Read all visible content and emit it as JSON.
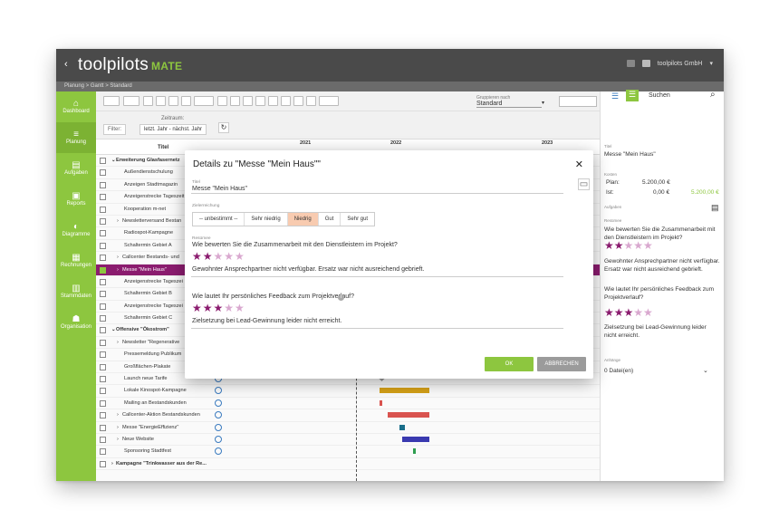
{
  "app": {
    "name": "toolpilots",
    "suffix": "MATE",
    "user": "toolpilots GmbH"
  },
  "breadcrumb": "Planung > Gantt > Standard",
  "sidebar": {
    "items": [
      {
        "label": "Dashboard",
        "icon": "home-icon"
      },
      {
        "label": "Planung",
        "icon": "list-icon"
      },
      {
        "label": "Aufgaben",
        "icon": "document-icon"
      },
      {
        "label": "Reports",
        "icon": "report-icon"
      },
      {
        "label": "Diagramme",
        "icon": "pie-icon"
      },
      {
        "label": "Rechnungen",
        "icon": "invoice-icon"
      },
      {
        "label": "Stammdaten",
        "icon": "database-icon"
      },
      {
        "label": "Organisation",
        "icon": "people-icon"
      }
    ]
  },
  "toolbar": {
    "group_label": "Gruppieren nach",
    "group_value": "Standard",
    "search_placeholder": "Suchen",
    "zoom_buttons": [
      "Q",
      "Q"
    ]
  },
  "filter": {
    "button": "Filter:",
    "range_label": "Zeitraum:",
    "range_value": "letzt. Jahr - nächst. Jahr"
  },
  "grid": {
    "title_col": "Titel",
    "years": [
      "2021",
      "2022",
      "2023"
    ],
    "rows": [
      {
        "label": "Erweiterung Glasfasernetz",
        "level": 0,
        "bold": true,
        "caret": "v"
      },
      {
        "label": "Außendienstschulung",
        "level": 1
      },
      {
        "label": "Anzeigen Stadtmagazin",
        "level": 1
      },
      {
        "label": "Anzeigenstrecke Tageszeit",
        "level": 1
      },
      {
        "label": "Kooperation m-net",
        "level": 1
      },
      {
        "label": "Newsletterversand Bestan",
        "level": 1,
        "caret": ">"
      },
      {
        "label": "Radiospot-Kampagne",
        "level": 1
      },
      {
        "label": "Schaltermin Gebiet A",
        "level": 1
      },
      {
        "label": "Callcenter Bestands- und",
        "level": 1,
        "caret": ">"
      },
      {
        "label": "Messe \"Mein Haus\"",
        "level": 1,
        "caret": ">",
        "selected": true
      },
      {
        "label": "Anzeigenstrecke Tageszei",
        "level": 1
      },
      {
        "label": "Schaltermin Gebiet B",
        "level": 1
      },
      {
        "label": "Anzeigenstrecke Tageszei",
        "level": 1
      },
      {
        "label": "Schaltermin Gebiet C",
        "level": 1
      },
      {
        "label": "Offensive \"Ökostrom\"",
        "level": 0,
        "bold": true,
        "caret": "v"
      },
      {
        "label": "Newsletter \"Regenerative",
        "level": 1,
        "caret": ">"
      },
      {
        "label": "Pressemeldung Publikum",
        "level": 1
      },
      {
        "label": "Großflächen-Plakate",
        "level": 1
      },
      {
        "label": "Launch neue Tarife",
        "level": 1
      },
      {
        "label": "Lokale Kinospot-Kampagne",
        "level": 1
      },
      {
        "label": "Mailing an Bestandskunden",
        "level": 1
      },
      {
        "label": "Callcenter-Aktion Bestandskunden",
        "level": 1,
        "caret": ">"
      },
      {
        "label": "Messe \"EnergieEffizienz\"",
        "level": 1,
        "caret": ">"
      },
      {
        "label": "Neue Website",
        "level": 1,
        "caret": ">"
      },
      {
        "label": "Sponsoring Stadtfest",
        "level": 1
      },
      {
        "label": "Kampagne \"Trinkwasser aus der Re...",
        "level": 0,
        "bold": true,
        "caret": ">"
      }
    ]
  },
  "right_panel": {
    "title_label": "Titel",
    "title": "Messe \"Mein Haus\"",
    "kosten_label": "Kosten",
    "plan_label": "Plan:",
    "plan_value": "5.200,00 €",
    "ist_label": "Ist:",
    "ist_value": "0,00 €",
    "ist_diff": "5.200,00 €",
    "aufgaben_label": "Aufgaben",
    "resumee_label": "Resümee",
    "q1": "Wie bewerten Sie die Zusammenarbeit mit den Dienstleistern im Projekt?",
    "a1": "Gewohnter Ansprechpartner nicht verfügbar. Ersatz war nicht ausreichend gebrieft.",
    "q2": "Wie lautet Ihr persönliches Feedback zum Projektverlauf?",
    "a2": "Zielsetzung bei Lead-Gewinnung leider nicht erreicht.",
    "anhaenge_label": "Anhänge",
    "anhaenge_value": "0 Datei(en)"
  },
  "dialog": {
    "title": "Details zu \"Messe \"Mein Haus\"\"",
    "title_label": "Titel",
    "title_value": "Messe \"Mein Haus\"",
    "ziel_label": "Zielerreichung",
    "segments": [
      "-- unbestimmt --",
      "Sehr niedrig",
      "Niedrig",
      "Gut",
      "Sehr gut"
    ],
    "selected_segment": "Niedrig",
    "resumee_label": "Resümee",
    "q1": "Wie bewerten Sie die Zusammenarbeit mit den Dienstleistern im Projekt?",
    "q1_rating": 2,
    "a1": "Gewohnter Ansprechpartner nicht verfügbar. Ersatz war nicht ausreichend gebrieft.",
    "q2": "Wie lautet Ihr persönliches Feedback zum Projektverlauf?",
    "q2_rating": 3,
    "a2": "Zielsetzung bei Lead-Gewinnung leider nicht erreicht.",
    "ok": "OK",
    "cancel": "ABBRECHEN",
    "max_rating": 5
  },
  "colors": {
    "green": "#8dc63f",
    "purple": "#8b1c6f",
    "dark": "#4a4a4a",
    "peach": "#f8cbb0",
    "star": "#8b1c6f",
    "star_empty": "#d9a8cf"
  }
}
